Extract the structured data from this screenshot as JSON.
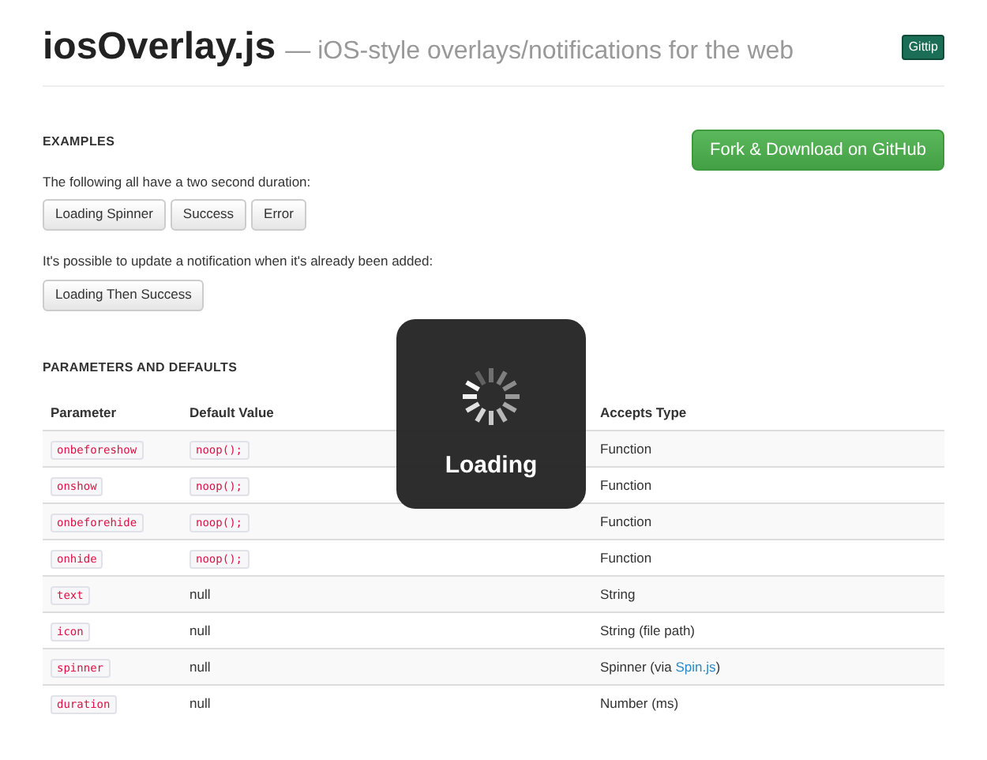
{
  "header": {
    "title": "iosOverlay.js",
    "subtitle": "— iOS-style overlays/notifications for the web",
    "badge": "Gittip"
  },
  "examples": {
    "heading": "EXAMPLES",
    "github_button": "Fork & Download on GitHub",
    "intro": "The following all have a two second duration:",
    "buttons": [
      "Loading Spinner",
      "Success",
      "Error"
    ],
    "update_text": "It's possible to update a notification when it's already been added:",
    "update_buttons": [
      "Loading Then Success"
    ]
  },
  "parameters": {
    "heading": "PARAMETERS AND DEFAULTS",
    "columns": [
      "Parameter",
      "Default Value",
      "Accepts Type"
    ],
    "rows": [
      {
        "parameter": "onbeforeshow",
        "default": {
          "kind": "code",
          "text": "noop();"
        },
        "type": "Function"
      },
      {
        "parameter": "onshow",
        "default": {
          "kind": "code",
          "text": "noop();"
        },
        "type": "Function"
      },
      {
        "parameter": "onbeforehide",
        "default": {
          "kind": "code",
          "text": "noop();"
        },
        "type": "Function"
      },
      {
        "parameter": "onhide",
        "default": {
          "kind": "code",
          "text": "noop();"
        },
        "type": "Function"
      },
      {
        "parameter": "text",
        "default": {
          "kind": "plain",
          "text": "null"
        },
        "type": "String"
      },
      {
        "parameter": "icon",
        "default": {
          "kind": "plain",
          "text": "null"
        },
        "type": "String (file path)"
      },
      {
        "parameter": "spinner",
        "default": {
          "kind": "plain",
          "text": "null"
        },
        "type": "Spinner (via ",
        "type_link": "Spin.js",
        "type_after": ")"
      },
      {
        "parameter": "duration",
        "default": {
          "kind": "plain",
          "text": "null"
        },
        "type": "Number (ms)"
      }
    ]
  },
  "overlay": {
    "text": "Loading"
  }
}
